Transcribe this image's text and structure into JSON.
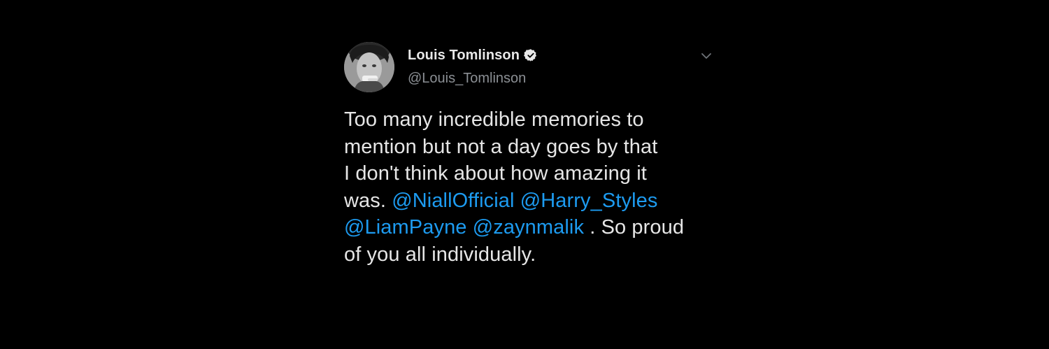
{
  "tweet": {
    "display_name": "Louis Tomlinson",
    "handle": "@Louis_Tomlinson",
    "verified_icon": "verified-badge-icon",
    "menu_icon": "chevron-down-icon",
    "text": {
      "line1": "Too many incredible memories to",
      "line2": "mention but not a day goes by that",
      "line3": "I don't think about how amazing it",
      "line4_prefix": "was.",
      "mention1": "@NiallOfficial",
      "mention2": "@Harry_Styles",
      "mention3": "@LiamPayne",
      "mention4": "@zaynmalik",
      "line5_suffix": ". So proud",
      "line6": "of you all individually."
    }
  },
  "colors": {
    "background": "#000000",
    "text": "#e6e6e6",
    "handle": "#8b8f94",
    "link": "#1d9bf0"
  }
}
